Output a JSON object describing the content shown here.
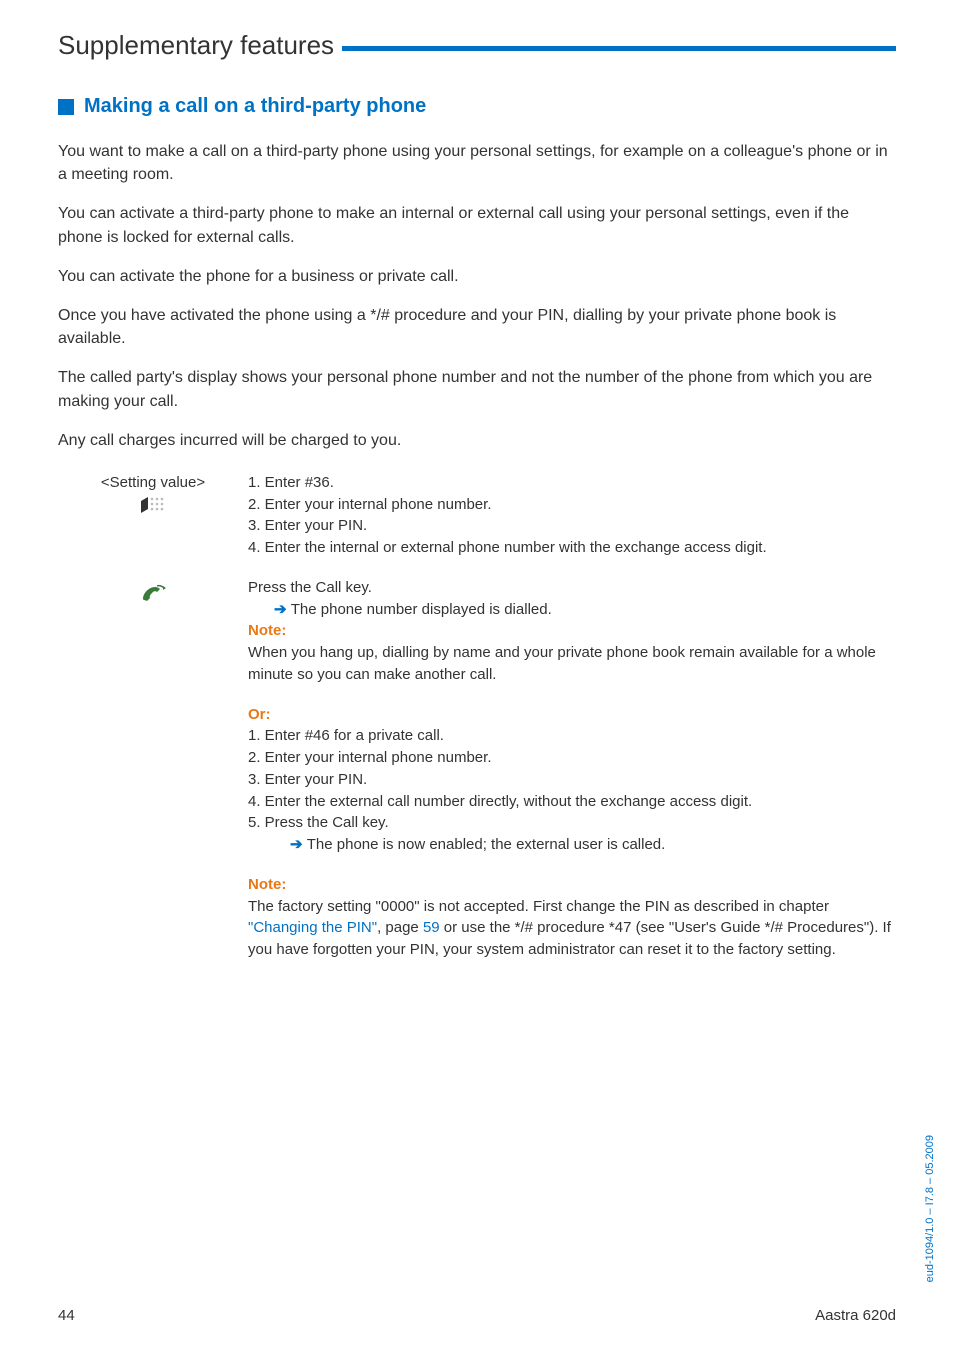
{
  "chapter": "Supplementary features",
  "section": {
    "title": "Making a call on a third-party phone"
  },
  "paragraphs": {
    "p1": "You want to make a call on a third-party phone using your personal settings, for example on a colleague's phone or in a meeting room.",
    "p2": "You can activate a third-party phone to make an internal or external call using your personal settings, even if the phone is locked for external calls.",
    "p3": "You can activate the phone for a business or private call.",
    "p4": "Once you have activated the phone using a */# procedure and your PIN, dialling by your private phone book is available.",
    "p5": "The called party's display shows your personal phone number and not the number of the phone from which you are making your call.",
    "p6": "Any call charges incurred will be charged to you."
  },
  "steps": {
    "setting_label": "<Setting value>",
    "list1": {
      "i1": "1.   Enter #36.",
      "i2": "2.   Enter your internal phone number.",
      "i3": "3.   Enter your PIN.",
      "i4": "4.   Enter the internal or external phone number with the exchange access digit."
    },
    "block2": {
      "line1": "Press the Call key.",
      "line2_after_arrow": "The phone number displayed is dialled.",
      "note_label": "Note:",
      "note_text": "When you hang up, dialling by name and your private phone book remain available for a whole minute so you can make another call."
    },
    "block3": {
      "or_label": "Or:",
      "i1": "1.   Enter #46 for a private call.",
      "i2": "2.   Enter your internal phone number.",
      "i3": "3.   Enter your PIN.",
      "i4": "4.   Enter the external call number directly, without the exchange access digit.",
      "i5": "5.   Press the Call key.",
      "result_after_arrow": "The phone is now enabled; the external user is called."
    },
    "note2": {
      "label": "Note:",
      "part1": "The factory setting \"0000\" is not accepted. First change the PIN as described in chapter ",
      "link1": "\"Changing the PIN\"",
      "mid": ", page ",
      "page_ref": "59",
      "part2": " or use the */# procedure *47 (see \"User's Guide */# Procedures\"). If you have forgotten your PIN, your system administrator can reset it to the factory setting."
    }
  },
  "footer": {
    "page_number": "44",
    "product": "Aastra 620d"
  },
  "side_label": "eud-1094/1.0 – I7.8 – 05.2009",
  "icons": {
    "keypad": "keypad-icon",
    "call": "call-icon"
  }
}
